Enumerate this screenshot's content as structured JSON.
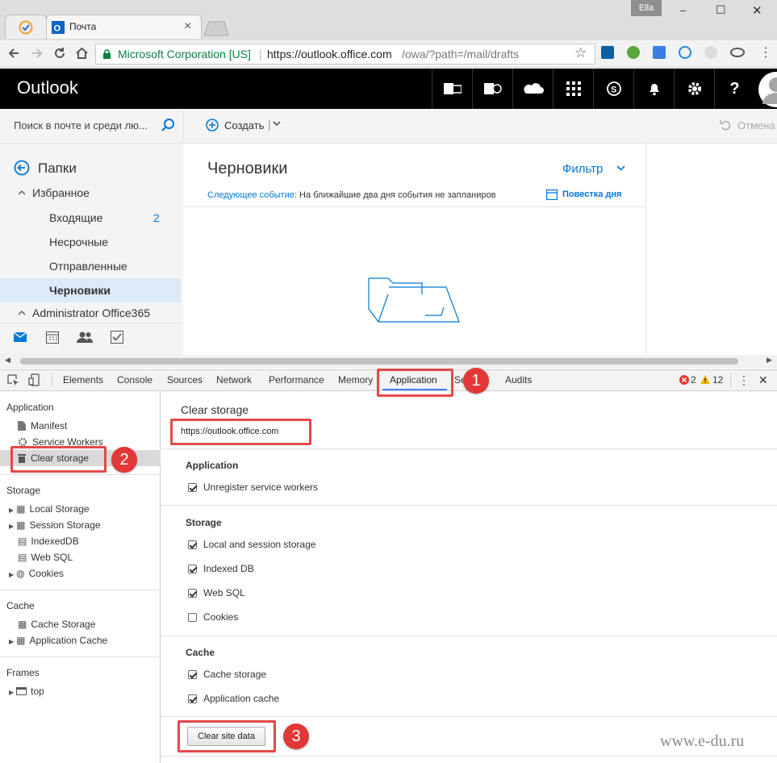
{
  "window": {
    "user": "Ella",
    "minimize": "–",
    "maximize": "☐",
    "close": "✕"
  },
  "tabs": [
    {
      "label": "Почта",
      "close": "×"
    }
  ],
  "address": {
    "secure_label": "Microsoft Corporation [US]",
    "url_host": "https://outlook.office.com",
    "url_path": "/owa/?path=/mail/drafts"
  },
  "outlook": {
    "brand": "Outlook",
    "search_placeholder": "Поиск в почте и среди лю...",
    "new_label": "Создать",
    "undo_label": "Отмена",
    "folders_label": "Папки",
    "favorites_label": "Избранное",
    "folders": [
      {
        "name": "Входящие",
        "count": "2"
      },
      {
        "name": "Несрочные",
        "count": ""
      },
      {
        "name": "Отправленные",
        "count": ""
      },
      {
        "name": "Черновики",
        "count": ""
      }
    ],
    "account": "Administrator Office365",
    "pane_title": "Черновики",
    "filter_label": "Фильтр",
    "next_event_label": "Следующее событие:",
    "next_event_text": "На ближайшие два дня события не запланиров",
    "agenda_label": "Повестка дня",
    "accent": "#0078d7"
  },
  "devtools": {
    "tabs": [
      "Elements",
      "Console",
      "Sources",
      "Network",
      "Performance",
      "Memory",
      "Application",
      "Se",
      "Audits"
    ],
    "errors": "2",
    "warnings": "12",
    "sidebar": {
      "application_header": "Application",
      "application_items": [
        "Manifest",
        "Service Workers",
        "Clear storage"
      ],
      "storage_header": "Storage",
      "storage_items": [
        "Local Storage",
        "Session Storage",
        "IndexedDB",
        "Web SQL",
        "Cookies"
      ],
      "cache_header": "Cache",
      "cache_items": [
        "Cache Storage",
        "Application Cache"
      ],
      "frames_header": "Frames",
      "frames_items": [
        "top"
      ]
    },
    "main": {
      "title": "Clear storage",
      "origin": "https://outlook.office.com",
      "application_header": "Application",
      "unregister": "Unregister service workers",
      "storage_header": "Storage",
      "storage_opts": [
        "Local and session storage",
        "Indexed DB",
        "Web SQL",
        "Cookies"
      ],
      "cache_header": "Cache",
      "cache_opts": [
        "Cache storage",
        "Application cache"
      ],
      "clear_button": "Clear site data"
    }
  },
  "annotations": [
    "1",
    "2",
    "3"
  ],
  "watermark": "www.e-du.ru"
}
